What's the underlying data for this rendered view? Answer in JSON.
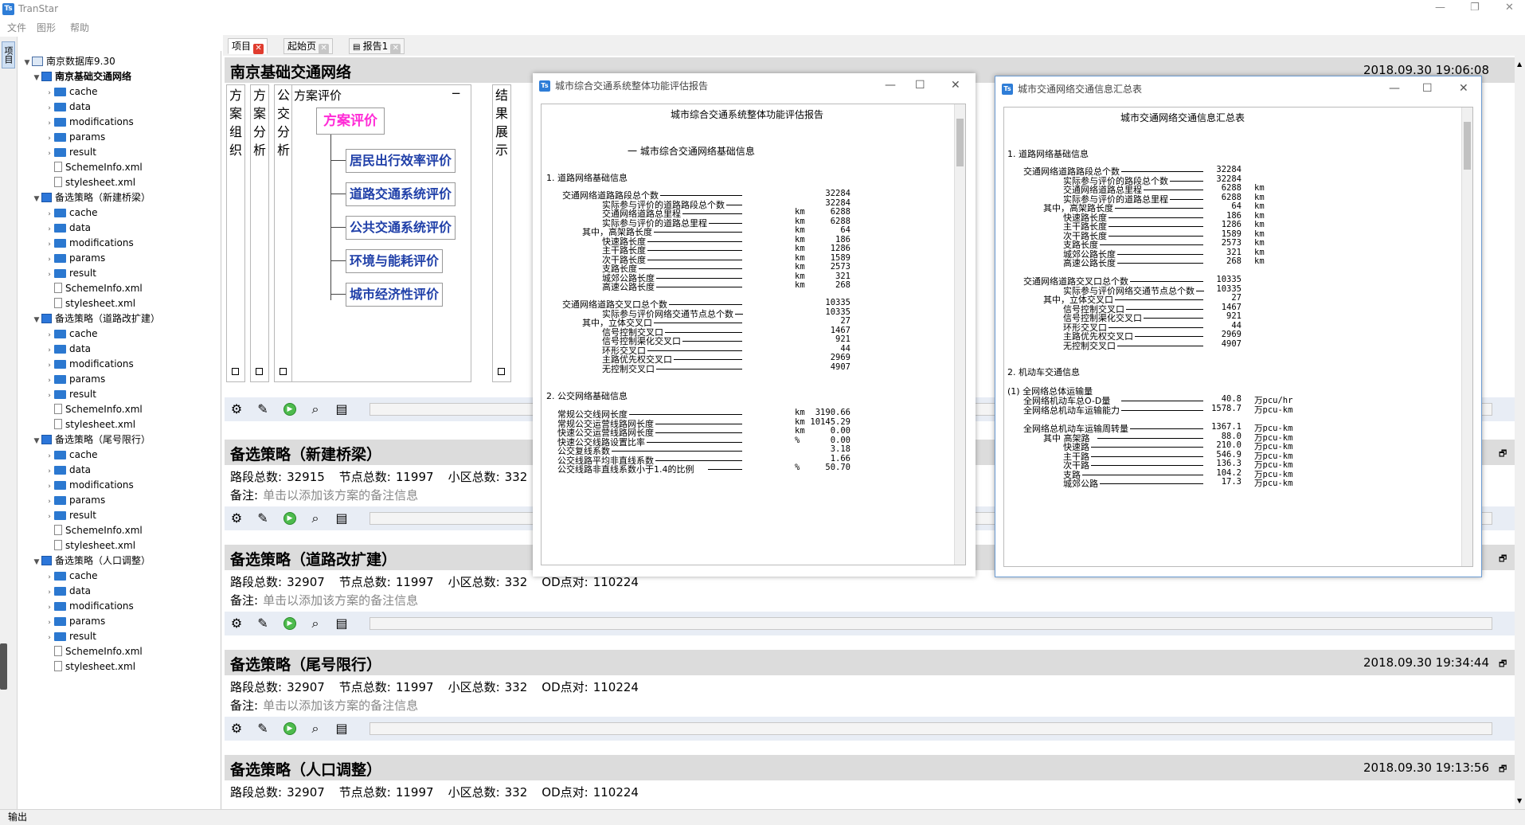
{
  "app": {
    "title": "TranStar",
    "icon": "Ts"
  },
  "menu": [
    "文件",
    "图形",
    "帮助"
  ],
  "side_tab": "项目",
  "tree": {
    "root": "南京数据库9.30",
    "schemes": [
      {
        "label": "南京基础交通网络",
        "children": [
          "cache",
          "data",
          "modifications",
          "params",
          "result",
          "SchemeInfo.xml",
          "stylesheet.xml"
        ]
      },
      {
        "label": "备选策略（新建桥梁）",
        "children": [
          "cache",
          "data",
          "modifications",
          "params",
          "result",
          "SchemeInfo.xml",
          "stylesheet.xml"
        ]
      },
      {
        "label": "备选策略（道路改扩建）",
        "children": [
          "cache",
          "data",
          "modifications",
          "params",
          "result",
          "SchemeInfo.xml",
          "stylesheet.xml"
        ]
      },
      {
        "label": "备选策略（尾号限行）",
        "children": [
          "cache",
          "data",
          "modifications",
          "params",
          "result",
          "SchemeInfo.xml",
          "stylesheet.xml"
        ]
      },
      {
        "label": "备选策略（人口调整）",
        "children": [
          "cache",
          "data",
          "modifications",
          "params",
          "result",
          "SchemeInfo.xml",
          "stylesheet.xml"
        ]
      }
    ]
  },
  "tabs": [
    {
      "label": "项目"
    },
    {
      "label": "起始页"
    },
    {
      "label": "报告1"
    }
  ],
  "main_project": {
    "title": "南京基础交通网络",
    "date": "2018.09.30  19:06:08"
  },
  "columns": {
    "c1": [
      "方",
      "案",
      "组",
      "织"
    ],
    "c2": [
      "方",
      "案",
      "分",
      "析"
    ],
    "c3": [
      "公",
      "交",
      "分",
      "析"
    ],
    "eval_header": "方案评价",
    "eval_minus": "−",
    "eval_root": "方案评价",
    "eval_children": [
      "居民出行效率评价",
      "道路交通系统评价",
      "公共交通系统评价",
      "环境与能耗评价",
      "城市经济性评价"
    ],
    "c5": [
      "结",
      "果",
      "展",
      "示"
    ]
  },
  "labels": {
    "segments": "路段总数:",
    "nodes": "节点总数:",
    "zones": "小区总数:",
    "od": "OD点对:",
    "note": "备注:",
    "note_hint": "单击以添加该方案的备注信息"
  },
  "panels": [
    {
      "title": "备选策略（新建桥梁）",
      "date": "",
      "segments": "32915",
      "nodes": "11997",
      "zones": "332",
      "od": "110224"
    },
    {
      "title": "备选策略（道路改扩建）",
      "date": "",
      "segments": "32907",
      "nodes": "11997",
      "zones": "332",
      "od": "110224"
    },
    {
      "title": "备选策略（尾号限行）",
      "date": "2018.09.30  19:34:44",
      "segments": "32907",
      "nodes": "11997",
      "zones": "332",
      "od": "110224"
    },
    {
      "title": "备选策略（人口调整）",
      "date": "2018.09.30  19:13:56",
      "segments": "32907",
      "nodes": "11997",
      "zones": "332",
      "od": "110224"
    }
  ],
  "status": "输出",
  "report1": {
    "window_title": "城市综合交通系统整体功能评估报告",
    "title": "城市综合交通系统整体功能评估报告",
    "chapter": "一 城市综合交通网络基础信息",
    "sec1": "1. 道路网络基础信息",
    "rows1": [
      {
        "label": "交通网络道路路段总个数",
        "value": "32284",
        "unit": ""
      },
      {
        "label": "实际参与评价的道路路段总个数",
        "value": "32284",
        "unit": ""
      },
      {
        "label": "交通网络道路总里程",
        "value": "6288",
        "unit": "km"
      },
      {
        "label": "实际参与评价的道路总里程",
        "value": "6288",
        "unit": "km"
      },
      {
        "label": "其中，高架路长度",
        "value": "64",
        "unit": "km"
      },
      {
        "label": "快速路长度",
        "value": "186",
        "unit": "km"
      },
      {
        "label": "主干路长度",
        "value": "1286",
        "unit": "km"
      },
      {
        "label": "次干路长度",
        "value": "1589",
        "unit": "km"
      },
      {
        "label": "支路长度",
        "value": "2573",
        "unit": "km"
      },
      {
        "label": "城郊公路长度",
        "value": "321",
        "unit": "km"
      },
      {
        "label": "高速公路长度",
        "value": "268",
        "unit": "km"
      }
    ],
    "rows2": [
      {
        "label": "交通网络道路交叉口总个数",
        "value": "10335"
      },
      {
        "label": "实际参与评价网络交通节点总个数",
        "value": "10335"
      },
      {
        "label": "其中，立体交叉口",
        "value": "27"
      },
      {
        "label": "信号控制交叉口",
        "value": "1467"
      },
      {
        "label": "信号控制渠化交叉口",
        "value": "921"
      },
      {
        "label": "环形交叉口",
        "value": "44"
      },
      {
        "label": "主路优先权交叉口",
        "value": "2969"
      },
      {
        "label": "无控制交叉口",
        "value": "4907"
      }
    ],
    "sec2": "2. 公交网络基础信息",
    "rows3": [
      {
        "label": "常规公交线网长度",
        "value": "3190.66",
        "unit": "km"
      },
      {
        "label": "常规公交运营线路网长度",
        "value": "10145.29",
        "unit": "km"
      },
      {
        "label": "快速公交运营线路网长度",
        "value": "0.00",
        "unit": "km"
      },
      {
        "label": "快速公交线路设置比率",
        "value": "0.00",
        "unit": "%"
      },
      {
        "label": "公交复线系数",
        "value": "3.18",
        "unit": ""
      },
      {
        "label": "公交线路平均非直线系数",
        "value": "1.66",
        "unit": ""
      },
      {
        "label": "公交线路非直线系数小于1.4的比例",
        "value": "50.70",
        "unit": "%"
      }
    ]
  },
  "report2": {
    "window_title": "城市交通网络交通信息汇总表",
    "title": "城市交通网络交通信息汇总表",
    "sec1": "1. 道路网络基础信息",
    "rows1": [
      {
        "label": "交通网络道路路段总个数",
        "value": "32284",
        "unit": ""
      },
      {
        "label": "实际参与评价的路段总个数",
        "value": "32284",
        "unit": ""
      },
      {
        "label": "交通网络道路总里程",
        "value": "6288",
        "unit": "km"
      },
      {
        "label": "实际参与评价的道路总里程",
        "value": "6288",
        "unit": "km"
      },
      {
        "label": "其中，高架路长度",
        "value": "64",
        "unit": "km"
      },
      {
        "label": "快速路长度",
        "value": "186",
        "unit": "km"
      },
      {
        "label": "主干路长度",
        "value": "1286",
        "unit": "km"
      },
      {
        "label": "次干路长度",
        "value": "1589",
        "unit": "km"
      },
      {
        "label": "支路长度",
        "value": "2573",
        "unit": "km"
      },
      {
        "label": "城郊公路长度",
        "value": "321",
        "unit": "km"
      },
      {
        "label": "高速公路长度",
        "value": "268",
        "unit": "km"
      }
    ],
    "rows2": [
      {
        "label": "交通网络道路交叉口总个数",
        "value": "10335"
      },
      {
        "label": "实际参与评价网络交通节点总个数",
        "value": "10335"
      },
      {
        "label": "其中，立体交叉口",
        "value": "27"
      },
      {
        "label": "信号控制交叉口",
        "value": "1467"
      },
      {
        "label": "信号控制渠化交叉口",
        "value": "921"
      },
      {
        "label": "环形交叉口",
        "value": "44"
      },
      {
        "label": "主路优先权交叉口",
        "value": "2969"
      },
      {
        "label": "无控制交叉口",
        "value": "4907"
      }
    ],
    "sec2": "2. 机动车交通信息",
    "sub1": "(1) 全网络总体运输量",
    "rows3": [
      {
        "label": "全网络机动车总O-D量",
        "value": "40.8",
        "unit": "万pcu/hr"
      },
      {
        "label": "全网络总机动车运输能力",
        "value": "1578.7",
        "unit": "万pcu-km"
      }
    ],
    "rows4": [
      {
        "label": "全网络总机动车运输周转量",
        "value": "1367.1",
        "unit": "万pcu-km"
      },
      {
        "label": "其中 高架路",
        "value": "88.0",
        "unit": "万pcu-km"
      },
      {
        "label": "快速路",
        "value": "210.0",
        "unit": "万pcu-km"
      },
      {
        "label": "主干路",
        "value": "546.9",
        "unit": "万pcu-km"
      },
      {
        "label": "次干路",
        "value": "136.3",
        "unit": "万pcu-km"
      },
      {
        "label": "支路",
        "value": "104.2",
        "unit": "万pcu-km"
      },
      {
        "label": "城郊公路",
        "value": "17.3",
        "unit": "万pcu-km"
      }
    ]
  }
}
